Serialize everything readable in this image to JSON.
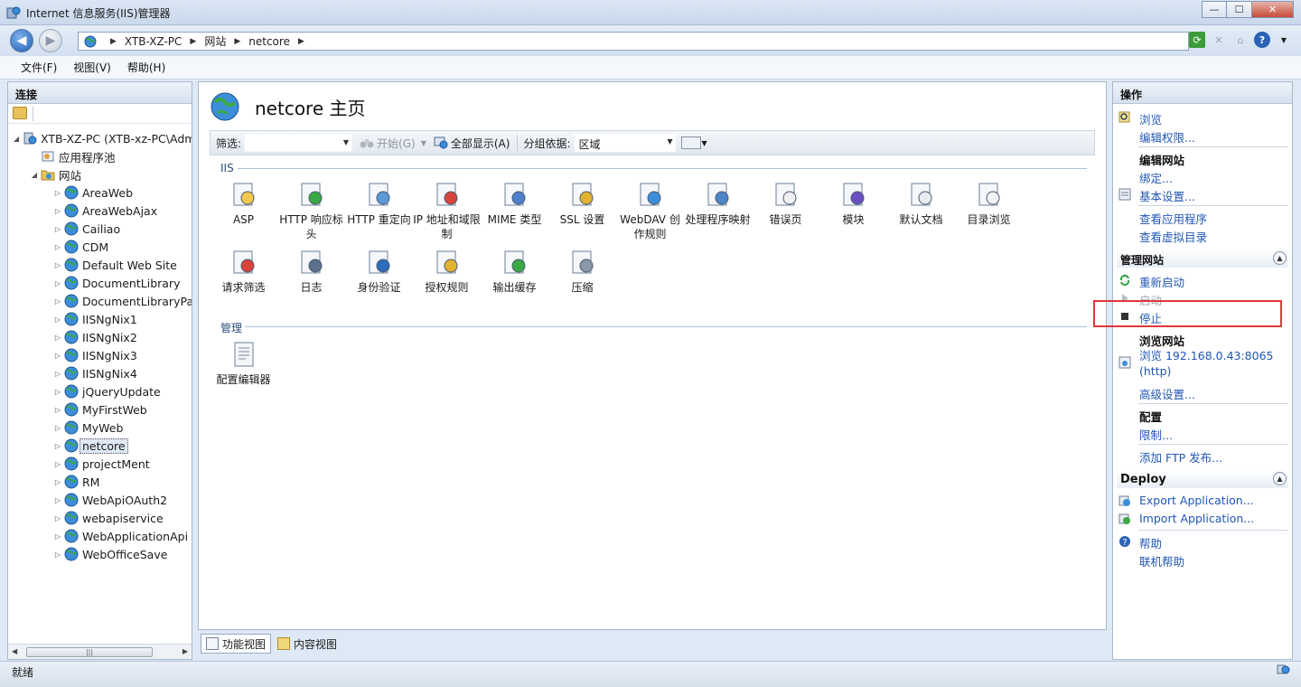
{
  "window": {
    "title": "Internet 信息服务(IIS)管理器",
    "buttons": {
      "minimize": "—",
      "maximize": "☐",
      "close": "✕"
    }
  },
  "address": {
    "crumbs": [
      "XTB-XZ-PC",
      "网站",
      "netcore"
    ]
  },
  "menu": [
    "文件(F)",
    "视图(V)",
    "帮助(H)"
  ],
  "connections": {
    "title": "连接",
    "server": "XTB-XZ-PC (XTB-xz-PC\\Adm",
    "app_pools": "应用程序池",
    "sites_folder": "网站",
    "sites": [
      "AreaWeb",
      "AreaWebAjax",
      "Cailiao",
      "CDM",
      "Default Web Site",
      "DocumentLibrary",
      "DocumentLibraryPag",
      "IISNgNix1",
      "IISNgNix2",
      "IISNgNix3",
      "IISNgNix4",
      "jQueryUpdate",
      "MyFirstWeb",
      "MyWeb",
      "netcore",
      "projectMent",
      "RM",
      "WebApiOAuth2",
      "webapiservice",
      "WebApplicationApi",
      "WebOfficeSave"
    ],
    "selected": "netcore"
  },
  "main": {
    "title": "netcore 主页",
    "filter": {
      "label": "筛选:",
      "start": "开始(G)",
      "show_all": "全部显示(A)",
      "group_label": "分组依据:",
      "group_value": "区域"
    },
    "sections": {
      "iis": "IIS",
      "manage": "管理"
    },
    "iis_features": [
      "ASP",
      "HTTP 响应标头",
      "HTTP 重定向",
      "IP 地址和域限制",
      "MIME 类型",
      "SSL 设置",
      "WebDAV 创作规则",
      "处理程序映射",
      "错误页",
      "模块",
      "默认文档",
      "目录浏览",
      "请求筛选",
      "日志",
      "身份验证",
      "授权规则",
      "输出缓存",
      "压缩"
    ],
    "manage_features": [
      "配置编辑器"
    ],
    "tabs": {
      "features": "功能视图",
      "content": "内容视图"
    }
  },
  "actions": {
    "title": "操作",
    "browse": "浏览",
    "edit_perms": "编辑权限...",
    "edit_site": "编辑网站",
    "bindings": "绑定...",
    "basic_settings": "基本设置...",
    "view_apps": "查看应用程序",
    "view_vdirs": "查看虚拟目录",
    "manage_site": "管理网站",
    "restart": "重新启动",
    "start": "启动",
    "stop": "停止",
    "browse_site": "浏览网站",
    "browse_url": "浏览 192.168.0.43:8065 (http)",
    "advanced": "高级设置...",
    "config": "配置",
    "limits": "限制...",
    "add_ftp": "添加 FTP 发布...",
    "deploy": "Deploy",
    "export_app": "Export Application...",
    "import_app": "Import Application...",
    "help": "帮助",
    "online_help": "联机帮助"
  },
  "status": {
    "text": "就绪"
  },
  "colors": {
    "link": "#2057b4",
    "highlight": "#e0383a",
    "section": "#2e4f7c"
  }
}
